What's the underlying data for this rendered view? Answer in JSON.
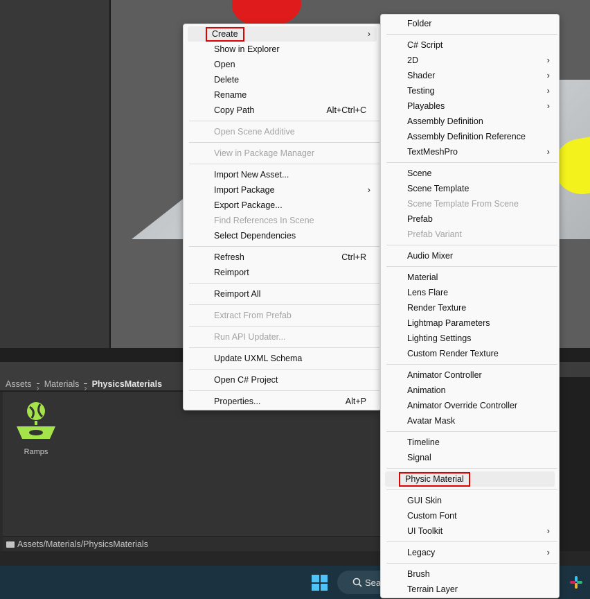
{
  "project": {
    "breadcrumb": [
      "Assets",
      "Materials",
      "PhysicsMaterials"
    ],
    "asset_label": "Ramps",
    "path": "Assets/Materials/PhysicsMaterials"
  },
  "taskbar": {
    "search_text": "Sea"
  },
  "context_menu": {
    "create": "Create",
    "show_in_explorer": "Show in Explorer",
    "open": "Open",
    "delete": "Delete",
    "rename": "Rename",
    "copy_path": "Copy Path",
    "copy_path_shortcut": "Alt+Ctrl+C",
    "open_scene_additive": "Open Scene Additive",
    "view_in_package_manager": "View in Package Manager",
    "import_new_asset": "Import New Asset...",
    "import_package": "Import Package",
    "export_package": "Export Package...",
    "find_references": "Find References In Scene",
    "select_dependencies": "Select Dependencies",
    "refresh": "Refresh",
    "refresh_shortcut": "Ctrl+R",
    "reimport": "Reimport",
    "reimport_all": "Reimport All",
    "extract_from_prefab": "Extract From Prefab",
    "run_api_updater": "Run API Updater...",
    "update_uxml_schema": "Update UXML Schema",
    "open_csharp_project": "Open C# Project",
    "properties": "Properties...",
    "properties_shortcut": "Alt+P"
  },
  "create_menu": {
    "folder": "Folder",
    "csharp_script": "C# Script",
    "two_d": "2D",
    "shader": "Shader",
    "testing": "Testing",
    "playables": "Playables",
    "assembly_definition": "Assembly Definition",
    "assembly_definition_reference": "Assembly Definition Reference",
    "textmeshpro": "TextMeshPro",
    "scene": "Scene",
    "scene_template": "Scene Template",
    "scene_template_from_scene": "Scene Template From Scene",
    "prefab": "Prefab",
    "prefab_variant": "Prefab Variant",
    "audio_mixer": "Audio Mixer",
    "material": "Material",
    "lens_flare": "Lens Flare",
    "render_texture": "Render Texture",
    "lightmap_parameters": "Lightmap Parameters",
    "lighting_settings": "Lighting Settings",
    "custom_render_texture": "Custom Render Texture",
    "animator_controller": "Animator Controller",
    "animation": "Animation",
    "animator_override_controller": "Animator Override Controller",
    "avatar_mask": "Avatar Mask",
    "timeline": "Timeline",
    "signal": "Signal",
    "physic_material": "Physic Material",
    "gui_skin": "GUI Skin",
    "custom_font": "Custom Font",
    "ui_toolkit": "UI Toolkit",
    "legacy": "Legacy",
    "brush": "Brush",
    "terrain_layer": "Terrain Layer"
  },
  "colors": {
    "highlight_box": "#e00000",
    "asset_icon": "#a5e34a",
    "menu_background": "#f9f9f9"
  }
}
